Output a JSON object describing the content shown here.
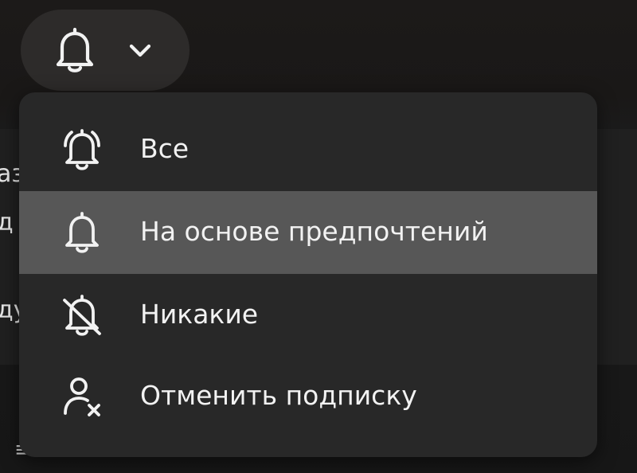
{
  "background_peek": {
    "line1": "аз",
    "line2": "д",
    "line3": "ду",
    "line4": "≡  · ·"
  },
  "bell_button": {
    "icon": "bell-icon",
    "dropdown_icon": "chevron-down-icon"
  },
  "menu": {
    "items": [
      {
        "icon": "bell-ringing-icon",
        "label": "Все",
        "selected": false
      },
      {
        "icon": "bell-icon",
        "label": "На основе предпочтений",
        "selected": true
      },
      {
        "icon": "bell-off-icon",
        "label": "Никакие",
        "selected": false
      },
      {
        "icon": "person-remove-icon",
        "label": "Отменить подписку",
        "selected": false
      }
    ]
  },
  "colors": {
    "page_background": "#1a1817",
    "pill_background": "#2d2b2a",
    "menu_background": "#282828",
    "selected_row": "#575757",
    "text": "#f2f2f2"
  }
}
